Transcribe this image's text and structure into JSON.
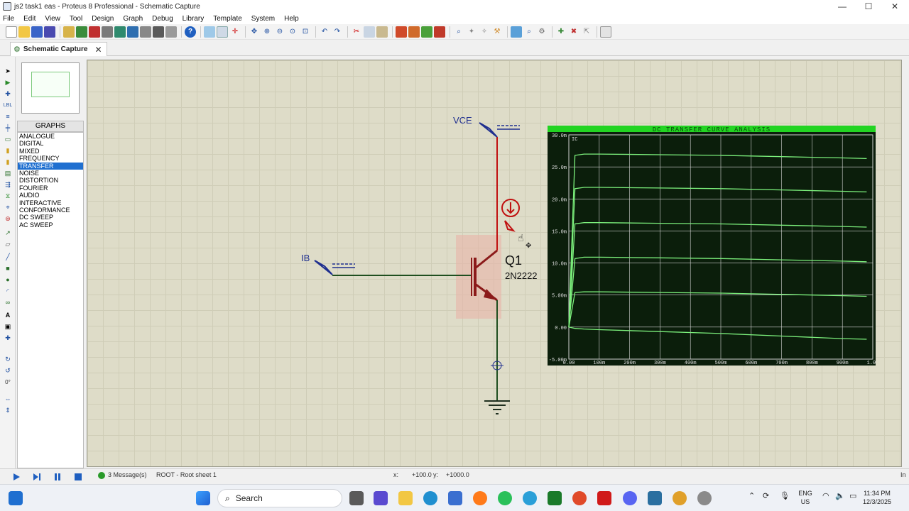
{
  "window": {
    "title": "js2 task1 eas - Proteus 8 Professional - Schematic Capture",
    "minimize": "—",
    "maximize": "☐",
    "close": "✕"
  },
  "menu": [
    "File",
    "Edit",
    "View",
    "Tool",
    "Design",
    "Graph",
    "Debug",
    "Library",
    "Template",
    "System",
    "Help"
  ],
  "tab": {
    "label": "Schematic Capture",
    "close": "✕"
  },
  "graphs_panel": {
    "header": "GRAPHS",
    "items": [
      "ANALOGUE",
      "DIGITAL",
      "MIXED",
      "FREQUENCY",
      "TRANSFER",
      "NOISE",
      "DISTORTION",
      "FOURIER",
      "AUDIO",
      "INTERACTIVE",
      "CONFORMANCE",
      "DC SWEEP",
      "AC SWEEP"
    ],
    "selected": "TRANSFER"
  },
  "left_tool_extra": "0°",
  "schematic": {
    "generator_vce": "VCE",
    "generator_ib": "IB",
    "transistor_ref": "Q1",
    "transistor_value": "2N2222",
    "net_color": "#1f4f1f",
    "active_wire_color": "#c01010"
  },
  "graph": {
    "title": "DC TRANSFER CURVE ANALYSIS",
    "trace_label": "IC",
    "y_ticks": [
      "30.0m",
      "25.0m",
      "20.0m",
      "15.0m",
      "10.0m",
      "5.00m",
      "0.00",
      "-5.00m"
    ],
    "x_ticks": [
      "0.00",
      "100m",
      "200m",
      "300m",
      "400m",
      "500m",
      "600m",
      "700m",
      "800m",
      "900m",
      "1.00"
    ],
    "colors": {
      "background": "#0b1e0b",
      "trace": "#7cf07c",
      "title_bar": "#22d422",
      "grid": "#d8d8d8"
    }
  },
  "chart_data": {
    "type": "line",
    "title": "DC TRANSFER CURVE ANALYSIS",
    "xlabel": "",
    "ylabel": "IC",
    "xlim": [
      0,
      1.0
    ],
    "ylim": [
      -0.005,
      0.03
    ],
    "x": [
      0,
      0.02,
      0.05,
      0.1,
      0.3,
      0.5,
      0.7,
      0.9,
      0.98
    ],
    "series": [
      {
        "values": [
          0,
          0.0268,
          0.027,
          0.027,
          0.0269,
          0.0268,
          0.0266,
          0.0264,
          0.0263
        ]
      },
      {
        "values": [
          0,
          0.0216,
          0.0218,
          0.0218,
          0.0217,
          0.0216,
          0.0214,
          0.0212,
          0.0211
        ]
      },
      {
        "values": [
          0,
          0.0161,
          0.0163,
          0.0163,
          0.0162,
          0.0161,
          0.0159,
          0.0157,
          0.0156
        ]
      },
      {
        "values": [
          0,
          0.0107,
          0.0109,
          0.0109,
          0.0108,
          0.0107,
          0.0105,
          0.0103,
          0.0102
        ]
      },
      {
        "values": [
          0,
          0.0054,
          0.0055,
          0.0055,
          0.0054,
          0.0053,
          0.0051,
          0.0049,
          0.0048
        ]
      },
      {
        "values": [
          0,
          -0.0002,
          -0.0003,
          -0.0004,
          -0.0007,
          -0.001,
          -0.0014,
          -0.0018,
          -0.0019
        ]
      }
    ],
    "grid": true,
    "legend": "none"
  },
  "status": {
    "messages": "3 Message(s)",
    "root": "ROOT - Root sheet 1",
    "x_label": "x:",
    "x_value": "+100.0",
    "y_label": "y:",
    "y_value": "+1000.0",
    "tail": "In"
  },
  "taskbar": {
    "search": "Search",
    "lang_top": "ENG",
    "lang_bottom": "US",
    "time": "11:34 PM",
    "date": "12/3/2025"
  }
}
